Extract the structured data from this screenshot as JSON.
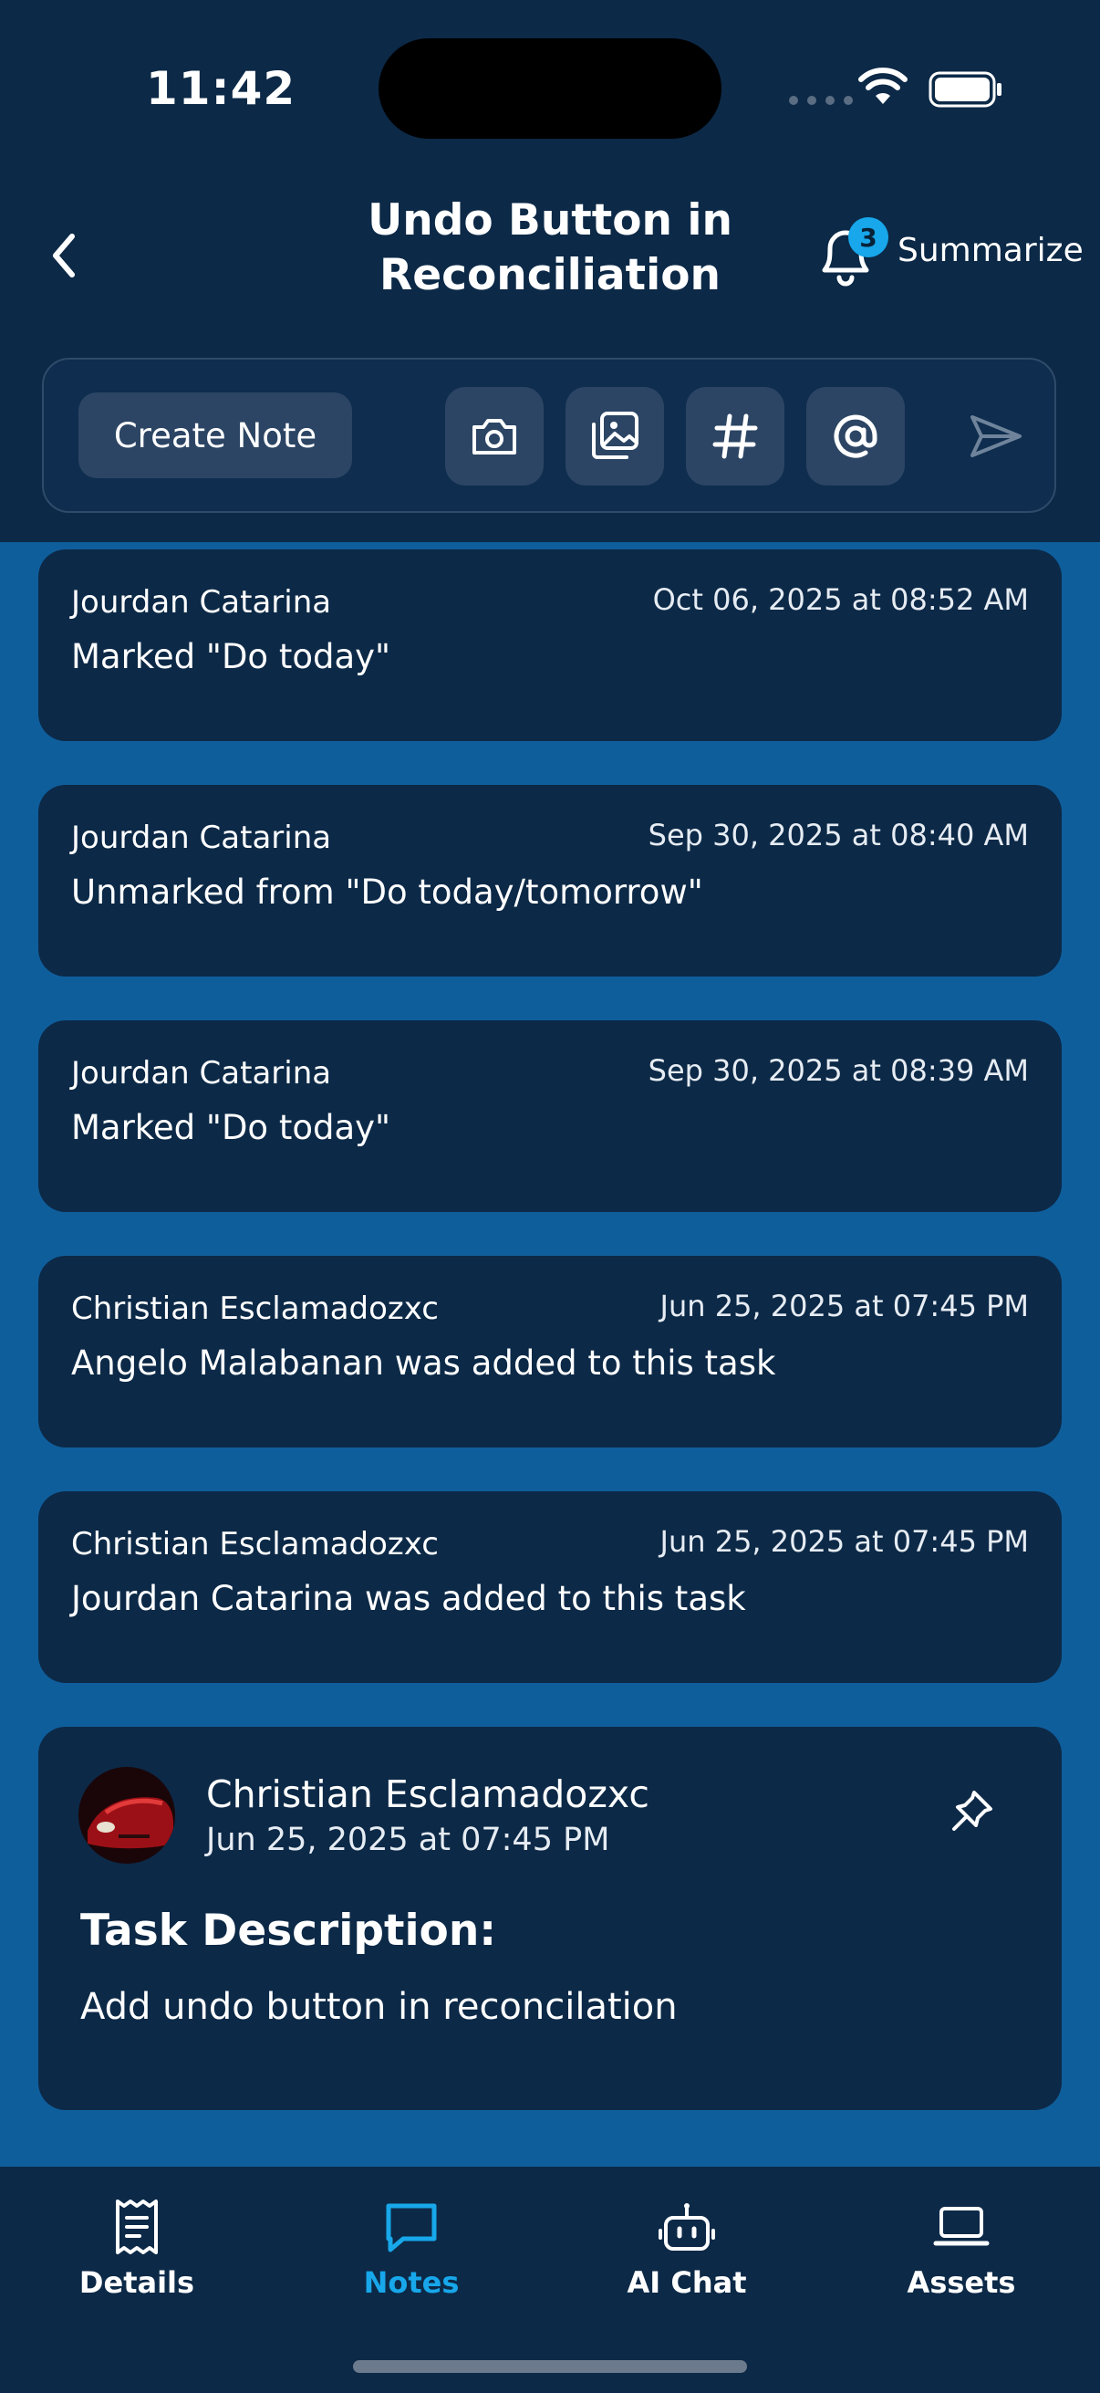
{
  "status_bar": {
    "time": "11:42"
  },
  "header": {
    "title_line1": "Undo Button in",
    "title_line2": "Reconciliation",
    "notification_count": "3",
    "summarize_label": "Summarize"
  },
  "composer": {
    "create_note_label": "Create Note",
    "tools": [
      "camera-icon",
      "image-gallery-icon",
      "hashtag-icon",
      "at-mention-icon",
      "send-icon"
    ]
  },
  "notes": [
    {
      "author": "Jourdan Catarina",
      "date": "Oct 06, 2025 at 08:52 AM",
      "text": "Marked \"Do today\""
    },
    {
      "author": "Jourdan Catarina",
      "date": "Sep 30, 2025 at 08:40 AM",
      "text": "Unmarked from \"Do today/tomorrow\""
    },
    {
      "author": "Jourdan Catarina",
      "date": "Sep 30, 2025 at 08:39 AM",
      "text": "Marked \"Do today\""
    },
    {
      "author": "Christian Esclamadozxc",
      "date": "Jun 25, 2025 at 07:45 PM",
      "text": "Angelo Malabanan was added to this task"
    },
    {
      "author": "Christian Esclamadozxc",
      "date": "Jun 25, 2025 at 07:45 PM",
      "text": "Jourdan Catarina was added to this task"
    }
  ],
  "description_card": {
    "author": "Christian Esclamadozxc",
    "date": "Jun 25, 2025 at 07:45 PM",
    "heading": "Task Description:",
    "text": "Add undo button in reconcilation"
  },
  "tabs": [
    {
      "label": "Details",
      "icon": "receipt-icon",
      "active": false
    },
    {
      "label": "Notes",
      "icon": "chat-bubble-icon",
      "active": true
    },
    {
      "label": "AI Chat",
      "icon": "robot-icon",
      "active": false
    },
    {
      "label": "Assets",
      "icon": "laptop-icon",
      "active": false
    }
  ],
  "colors": {
    "background": "#0f5e9c",
    "header": "#0c2947",
    "card": "#0c2947",
    "accent": "#17a7ea",
    "button": "#2c4564"
  }
}
